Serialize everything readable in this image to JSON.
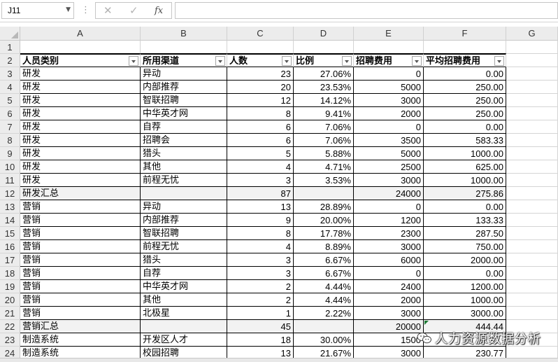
{
  "formula_bar": {
    "name_box": "J11",
    "cancel_icon": "x-icon",
    "enter_icon": "check-icon",
    "fx_label": "fx",
    "formula": ""
  },
  "columns": [
    "A",
    "B",
    "C",
    "D",
    "E",
    "F",
    "G"
  ],
  "header_row": {
    "row": "2",
    "cells": [
      "人员类别",
      "所用渠道",
      "人数",
      "比例",
      "招聘费用",
      "平均招聘费用"
    ]
  },
  "rows": [
    {
      "row": "1",
      "type": "empty",
      "cells": [
        "",
        "",
        "",
        "",
        "",
        ""
      ]
    },
    {
      "row": "3",
      "type": "data",
      "cells": [
        "研发",
        "异动",
        "23",
        "27.06%",
        "0",
        "0.00"
      ]
    },
    {
      "row": "4",
      "type": "data",
      "cells": [
        "研发",
        "内部推荐",
        "20",
        "23.53%",
        "5000",
        "250.00"
      ]
    },
    {
      "row": "5",
      "type": "data",
      "cells": [
        "研发",
        "智联招聘",
        "12",
        "14.12%",
        "3000",
        "250.00"
      ]
    },
    {
      "row": "6",
      "type": "data",
      "cells": [
        "研发",
        "中华英才网",
        "8",
        "9.41%",
        "2000",
        "250.00"
      ]
    },
    {
      "row": "7",
      "type": "data",
      "cells": [
        "研发",
        "自荐",
        "6",
        "7.06%",
        "0",
        "0.00"
      ]
    },
    {
      "row": "8",
      "type": "data",
      "cells": [
        "研发",
        "招聘会",
        "6",
        "7.06%",
        "3500",
        "583.33"
      ]
    },
    {
      "row": "9",
      "type": "data",
      "cells": [
        "研发",
        "猎头",
        "5",
        "5.88%",
        "5000",
        "1000.00"
      ]
    },
    {
      "row": "10",
      "type": "data",
      "cells": [
        "研发",
        "其他",
        "4",
        "4.71%",
        "2500",
        "625.00"
      ]
    },
    {
      "row": "11",
      "type": "data",
      "cells": [
        "研发",
        "前程无忧",
        "3",
        "3.53%",
        "3000",
        "1000.00"
      ]
    },
    {
      "row": "12",
      "type": "subtotal",
      "cells": [
        "研发汇总",
        "",
        "87",
        "",
        "24000",
        "275.86"
      ]
    },
    {
      "row": "13",
      "type": "data",
      "cells": [
        "营销",
        "异动",
        "13",
        "28.89%",
        "0",
        "0.00"
      ]
    },
    {
      "row": "14",
      "type": "data",
      "cells": [
        "营销",
        "内部推荐",
        "9",
        "20.00%",
        "1200",
        "133.33"
      ]
    },
    {
      "row": "15",
      "type": "data",
      "cells": [
        "营销",
        "智联招聘",
        "8",
        "17.78%",
        "2300",
        "287.50"
      ]
    },
    {
      "row": "16",
      "type": "data",
      "cells": [
        "营销",
        "前程无忧",
        "4",
        "8.89%",
        "3000",
        "750.00"
      ]
    },
    {
      "row": "17",
      "type": "data",
      "cells": [
        "营销",
        "猎头",
        "3",
        "6.67%",
        "6000",
        "2000.00"
      ]
    },
    {
      "row": "18",
      "type": "data",
      "cells": [
        "营销",
        "自荐",
        "3",
        "6.67%",
        "0",
        "0.00"
      ]
    },
    {
      "row": "19",
      "type": "data",
      "cells": [
        "营销",
        "中华英才网",
        "2",
        "4.44%",
        "2400",
        "1200.00"
      ]
    },
    {
      "row": "20",
      "type": "data",
      "cells": [
        "营销",
        "其他",
        "2",
        "4.44%",
        "2000",
        "1000.00"
      ]
    },
    {
      "row": "21",
      "type": "data",
      "cells": [
        "营销",
        "北极星",
        "1",
        "2.22%",
        "3000",
        "3000.00"
      ]
    },
    {
      "row": "22",
      "type": "subtotal",
      "cells": [
        "营销汇总",
        "",
        "45",
        "",
        "20000",
        "444.44"
      ]
    },
    {
      "row": "23",
      "type": "data",
      "cells": [
        "制造系统",
        "开发区人才",
        "18",
        "30.00%",
        "1500",
        ""
      ]
    },
    {
      "row": "24",
      "type": "data",
      "cells": [
        "制造系统",
        "校园招聘",
        "13",
        "21.67%",
        "3000",
        "230.77"
      ]
    }
  ],
  "watermark": {
    "text": "人力资源数据分析",
    "icon": "wechat-icon"
  },
  "colors": {
    "header_bg": "#ececec",
    "subtotal_bg": "#f2f2f2",
    "grid_line": "#d4d4d4",
    "indicator_green": "#1e7b36"
  }
}
